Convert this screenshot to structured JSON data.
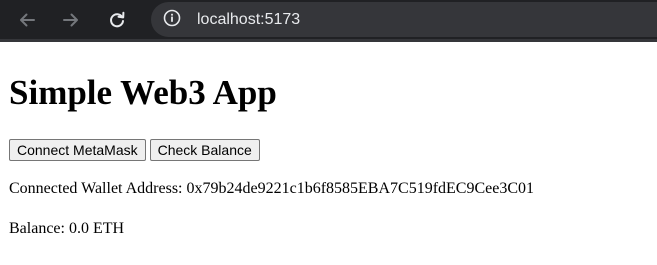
{
  "browser": {
    "url": "localhost:5173",
    "chrome_color": "#202124",
    "omnibox_color": "#35363a",
    "icons": {
      "back": "arrow-left-icon",
      "forward": "arrow-right-icon",
      "reload": "reload-icon",
      "site_info": "info-circle-icon"
    }
  },
  "page": {
    "title": "Simple Web3 App",
    "buttons": {
      "connect_label": "Connect MetaMask",
      "balance_label": "Check Balance"
    },
    "wallet": {
      "address_label": "Connected Wallet Address:",
      "address_value": "0x79b24de9221c1b6f8585EBA7C519fdEC9Cee3C01"
    },
    "balance": {
      "label": "Balance:",
      "value": "0.0 ETH"
    }
  }
}
